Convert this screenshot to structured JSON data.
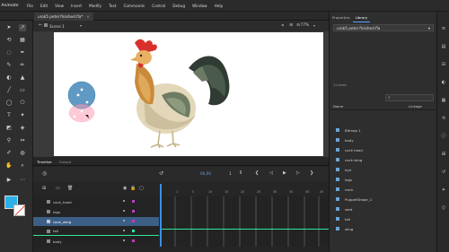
{
  "app": {
    "name": "Animate"
  },
  "menu": [
    "File",
    "Edit",
    "View",
    "Insert",
    "Modify",
    "Text",
    "Commands",
    "Control",
    "Debug",
    "Window",
    "Help"
  ],
  "document_tab": {
    "title": "urok5 petel finished.fla*",
    "close": "×"
  },
  "tools_panel": {
    "title": "Tools"
  },
  "stage_header": {
    "scene": "Scene 1",
    "zoom": "77%"
  },
  "colors": {
    "stroke": "#2db1e8",
    "fill": "#ffffff",
    "accent": "#3d8ee6",
    "selected_layer": "#3d5f86"
  },
  "timeline": {
    "tabs": [
      "Timeline",
      "Output"
    ],
    "current_frame": "00,00",
    "fps": "1",
    "ruler": [
      "1",
      "5",
      "10",
      "15",
      "20",
      "25",
      "30",
      "35",
      "40",
      "45"
    ],
    "layers": [
      {
        "name": "cock_haed",
        "color": "#c23ac2"
      },
      {
        "name": "legs",
        "color": "#c23ac2"
      },
      {
        "name": "cock_wing",
        "color": "#c23ac2",
        "selected": true
      },
      {
        "name": "tail",
        "color": "#2ee89a"
      },
      {
        "name": "body",
        "color": "#c23ac2"
      }
    ]
  },
  "right_panel": {
    "tabs": [
      "Properties",
      "Library"
    ],
    "active_tab": "Library",
    "file": "urok5 petel finished.fla",
    "items_count": "11 items",
    "header_name": "Name",
    "header_linkage": "Linkage",
    "items": [
      "Bitmap 1",
      "body",
      "cock head",
      "cock wing",
      "eye",
      "legs",
      "neck",
      "PuppetShape_1",
      "seat",
      "tail",
      "wing"
    ]
  }
}
